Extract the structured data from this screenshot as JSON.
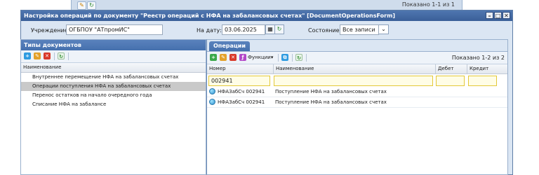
{
  "background_window": {
    "paging": "Показано 1-1 из 1"
  },
  "window": {
    "title": "Настройка операций по документу \"Реестр операций с НФА на забалансовых счетах\" [DocumentOperationsForm]",
    "controls": {
      "minimize": "–",
      "maximize": "□",
      "close": "✕"
    }
  },
  "filters": {
    "institution_label": "Учреждение:",
    "institution_value": "ОГБПОУ \"АТпромИС\"",
    "date_label": "На дату:",
    "date_value": "03.06.2025",
    "state_label": "Состояние:",
    "state_value": "Все записи",
    "calendar_glyph": "▦",
    "dropdown_glyph": "⌄"
  },
  "left_panel": {
    "title": "Типы документов",
    "column": "Наименование",
    "items": [
      "Внутреннее перемещение НФА на забалансовых счетах",
      "Операции поступления НФА на забалансовых счетах",
      "Перенос остатков на начало очередного года",
      "Списание НФА на забалансе"
    ],
    "selected_index": 1
  },
  "right_panel": {
    "tab": "Операции",
    "functions_label": "Функции▾",
    "paging": "Показано 1-2 из 2",
    "columns": {
      "number": "Номер",
      "name": "Наименование",
      "debit": "Дебет",
      "credit": "Кредит"
    },
    "filter_number": "002941",
    "rows": [
      {
        "number": "НФАЗабСч 002941",
        "name": "Поступление НФА на забалансовых счетах"
      },
      {
        "number": "НФАЗабСч 002941",
        "name": "Поступление НФА на забалансовых счетах"
      }
    ]
  },
  "colors": {
    "accent": "#4570ad",
    "selected_row": "#c9c9c9",
    "filter_highlight": "#e3c83a"
  },
  "icons": {
    "add": "add-icon",
    "edit": "edit-icon",
    "delete": "delete-icon",
    "refresh": "refresh-icon",
    "copy": "copy-icon",
    "functions": "functions-icon",
    "status": "status-icon"
  }
}
